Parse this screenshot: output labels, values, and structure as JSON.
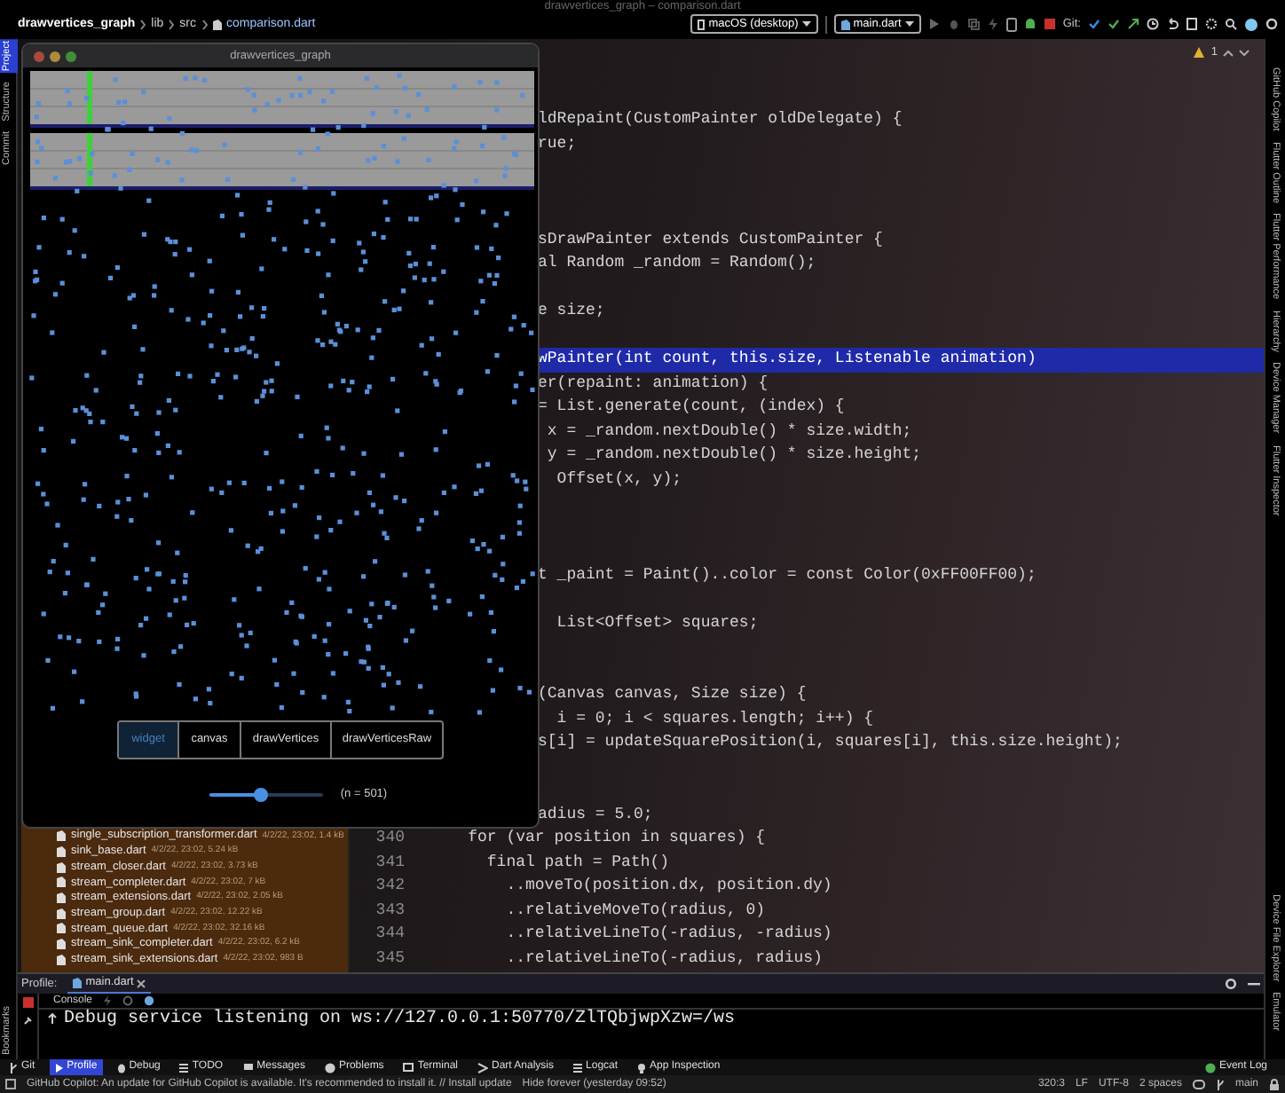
{
  "window": {
    "title": "drawvertices_graph – comparison.dart"
  },
  "breadcrumb": [
    "drawvertices_graph",
    "lib",
    "src",
    "comparison.dart"
  ],
  "toolbar": {
    "device": "macOS (desktop)",
    "run_config": "main.dart",
    "git_label": "Git:"
  },
  "left_tool_strip": [
    {
      "label": "Project",
      "selected": true
    },
    {
      "label": "Structure",
      "selected": false
    },
    {
      "label": "Commit",
      "selected": false
    }
  ],
  "bookmarks_label": "Bookmarks",
  "right_tool_strip": {
    "top": [
      "GitHub Copilot",
      "Flutter Outline",
      "Flutter Performance",
      "Hierarchy",
      "Device Manager",
      "Flutter Inspector"
    ],
    "bottom": [
      "Device File Explorer",
      "Emulator"
    ]
  },
  "inspection_widget": {
    "warnings": "1"
  },
  "app_window": {
    "title": "drawvertices_graph",
    "modes": [
      {
        "label": "widget",
        "selected": true
      },
      {
        "label": "canvas",
        "selected": false
      },
      {
        "label": "drawVertices",
        "selected": false
      },
      {
        "label": "drawVerticesRaw",
        "selected": false
      }
    ],
    "slider": {
      "level": 0.45
    },
    "count_label": "(n = 501)"
  },
  "project_files": [
    {
      "name": "single_subscription_transformer.dart",
      "meta": "4/2/22, 23:02, 1.4 kB"
    },
    {
      "name": "sink_base.dart",
      "meta": "4/2/22, 23:02, 5.24 kB"
    },
    {
      "name": "stream_closer.dart",
      "meta": "4/2/22, 23:02, 3.73 kB"
    },
    {
      "name": "stream_completer.dart",
      "meta": "4/2/22, 23:02, 7 kB"
    },
    {
      "name": "stream_extensions.dart",
      "meta": "4/2/22, 23:02, 2.05 kB"
    },
    {
      "name": "stream_group.dart",
      "meta": "4/2/22, 23:02, 12.22 kB"
    },
    {
      "name": "stream_queue.dart",
      "meta": "4/2/22, 23:02, 32.16 kB"
    },
    {
      "name": "stream_sink_completer.dart",
      "meta": "4/2/22, 23:02, 6.2 kB"
    },
    {
      "name": "stream_sink_extensions.dart",
      "meta": "4/2/22, 23:02, 983 B"
    }
  ],
  "code_lines": [
    {
      "kind": "code",
      "text": "ldRepaint(CustomPainter oldDelegate) {",
      "highlighted": false
    },
    {
      "kind": "code",
      "text": "rue;",
      "highlighted": false
    },
    {
      "kind": "blank"
    },
    {
      "kind": "blank"
    },
    {
      "kind": "blank"
    },
    {
      "kind": "code",
      "text": "sDrawPainter extends CustomPainter {",
      "highlighted": false
    },
    {
      "kind": "code",
      "text": "al Random _random = Random();",
      "highlighted": false
    },
    {
      "kind": "blank"
    },
    {
      "kind": "code",
      "text": "e size;",
      "highlighted": false
    },
    {
      "kind": "blank"
    },
    {
      "kind": "code",
      "text": "wPainter(int count, this.size, Listenable animation)",
      "highlighted": true
    },
    {
      "kind": "code",
      "text": "er(repaint: animation) {",
      "highlighted": false
    },
    {
      "kind": "code",
      "text": "= List.generate(count, (index) {",
      "highlighted": false
    },
    {
      "kind": "code",
      "text": " x = _random.nextDouble() * size.width;",
      "highlighted": false
    },
    {
      "kind": "code",
      "text": " y = _random.nextDouble() * size.height;",
      "highlighted": false
    },
    {
      "kind": "code",
      "text": "  Offset(x, y);",
      "highlighted": false
    },
    {
      "kind": "blank"
    },
    {
      "kind": "blank"
    },
    {
      "kind": "blank"
    },
    {
      "kind": "code",
      "text": "t _paint = Paint()..color = const Color(0xFF00FF00);",
      "highlighted": false
    },
    {
      "kind": "blank"
    },
    {
      "kind": "code",
      "text": "  List<Offset> squares;",
      "highlighted": false
    },
    {
      "kind": "blank"
    },
    {
      "kind": "blank"
    },
    {
      "kind": "code",
      "text": "(Canvas canvas, Size size) {",
      "highlighted": false
    },
    {
      "kind": "code",
      "text": "  i = 0; i < squares.length; i++) {",
      "highlighted": false
    },
    {
      "kind": "code",
      "text": "s[i] = updateSquarePosition(i, squares[i], this.size.height);",
      "highlighted": false
    },
    {
      "kind": "blank"
    },
    {
      "kind": "blank"
    },
    {
      "kind": "code",
      "text": "adius = 5.0;",
      "highlighted": false
    },
    {
      "kind": "numbered",
      "number": "340",
      "text": "    for (var position in squares) {"
    },
    {
      "kind": "numbered",
      "number": "341",
      "text": "      final path = Path()"
    },
    {
      "kind": "numbered",
      "number": "342",
      "text": "        ..moveTo(position.dx, position.dy)"
    },
    {
      "kind": "numbered",
      "number": "343",
      "text": "        ..relativeMoveTo(radius, 0)"
    },
    {
      "kind": "numbered",
      "number": "344",
      "text": "        ..relativeLineTo(-radius, -radius)"
    },
    {
      "kind": "numbered",
      "number": "345",
      "text": "        ..relativeLineTo(-radius, radius)"
    }
  ],
  "run_panel": {
    "label": "Profile:",
    "tab": "main.dart",
    "console_tab": "Console",
    "output": "Debug service listening on ws://127.0.0.1:50770/ZlTQbjwpXzw=/ws"
  },
  "tool_tabs": [
    {
      "label": "Git",
      "selected": false
    },
    {
      "label": "Profile",
      "selected": true
    },
    {
      "label": "Debug",
      "selected": false
    },
    {
      "label": "TODO",
      "selected": false
    },
    {
      "label": "Messages",
      "selected": false
    },
    {
      "label": "Problems",
      "selected": false
    },
    {
      "label": "Terminal",
      "selected": false
    },
    {
      "label": "Dart Analysis",
      "selected": false
    },
    {
      "label": "Logcat",
      "selected": false
    },
    {
      "label": "App Inspection",
      "selected": false
    }
  ],
  "event_log": "Event Log",
  "status_bar": {
    "message": "GitHub Copilot: An update for GitHub Copilot is available. It's recommended to install it. // Install update",
    "hide": "Hide forever (yesterday 09:52)",
    "position": "320:3",
    "line_ending": "LF",
    "encoding": "UTF-8",
    "indent": "2 spaces",
    "branch": "main"
  }
}
